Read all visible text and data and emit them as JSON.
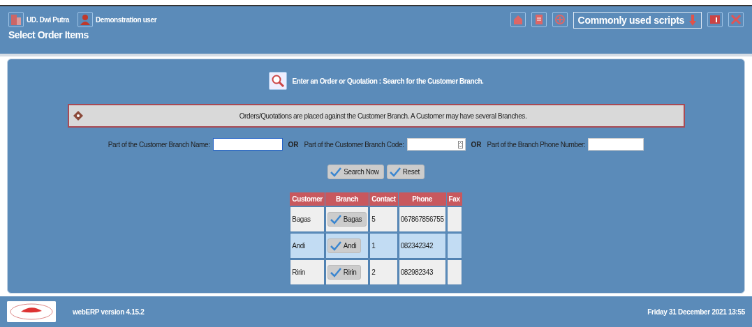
{
  "header": {
    "company": "UD. Dwi Putra",
    "user": "Demonstration user",
    "title": "Select Order Items",
    "scripts_menu": "Commonly used scripts"
  },
  "search": {
    "heading": "Enter an Order or Quotation : Search for the Customer Branch.",
    "info": "Orders/Quotations are placed against the Customer Branch. A Customer may have several Branches.",
    "fields": [
      {
        "label": "Part of the Customer Branch Name:",
        "focused": true
      },
      {
        "separator": "OR",
        "label": "Part of the Customer Branch Code:",
        "focused": false,
        "spinner": true
      },
      {
        "separator": "OR",
        "label": "Part of the Branch Phone Number:",
        "focused": false
      }
    ],
    "buttons": [
      "Search Now",
      "Reset"
    ]
  },
  "table": {
    "columns": [
      "Customer",
      "Branch",
      "Contact",
      "Phone",
      "Fax"
    ],
    "rows": [
      {
        "customer": "Bagas",
        "branch": "Bagas",
        "contact": "5",
        "phone": "067867856755"
      },
      {
        "customer": "Andi",
        "branch": "Andi",
        "contact": "1",
        "phone": "082342342"
      },
      {
        "customer": "Ririn",
        "branch": "Ririn",
        "contact": "2",
        "phone": "082982343"
      }
    ]
  },
  "footer": {
    "version": "webERP version 4.15.2",
    "datetime": "Friday 31 December 2021 13:55"
  }
}
